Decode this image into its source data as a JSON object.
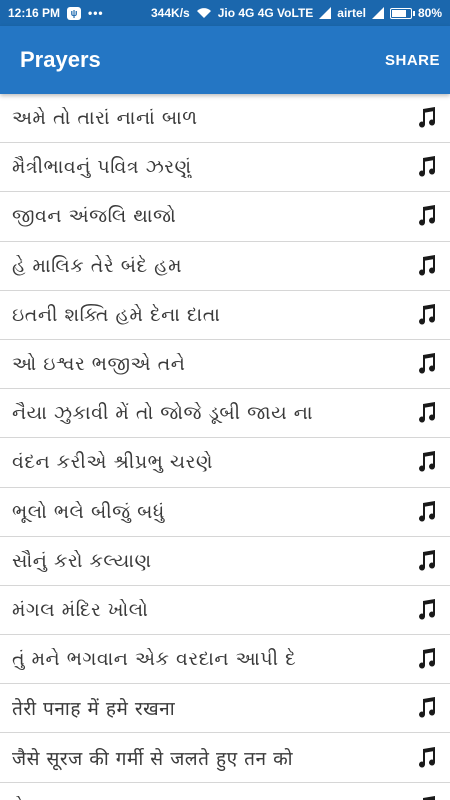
{
  "status_bar": {
    "time": "12:16 PM",
    "speed": "344K/s",
    "carrier1": "Jio 4G 4G VoLTE",
    "carrier2": "airtel",
    "battery": "80%",
    "battery_level": 0.8
  },
  "app_bar": {
    "title": "Prayers",
    "share_label": "SHARE"
  },
  "colors": {
    "status_bar": "#1b67ad",
    "app_bar": "#2476c4",
    "divider": "#d6d6d6",
    "text": "#3a3a3a"
  },
  "prayers": [
    {
      "title": "અમે તો તારાં નાનાં બાળ",
      "icon": "music-note-icon"
    },
    {
      "title": "મૈત્રીભાવનું પવિત્ર ઝરણું",
      "icon": "music-note-icon"
    },
    {
      "title": "જીવન અંજલિ થાજો",
      "icon": "music-note-icon"
    },
    {
      "title": "હે માલિક તેરે બંદે હમ",
      "icon": "music-note-icon"
    },
    {
      "title": "ઇતની શક્તિ હમે દેના દાતા",
      "icon": "music-note-icon"
    },
    {
      "title": "ઓ ઇશ્વર ભજીએ તને",
      "icon": "music-note-icon"
    },
    {
      "title": "નૈયા ઝુકાવી મેં તો જોજે ડૂબી જાય ના",
      "icon": "music-note-icon"
    },
    {
      "title": "વંદન કરીએ શ્રીપ્રભુ ચરણે",
      "icon": "music-note-icon"
    },
    {
      "title": "ભૂલો ભલે બીજું બધું",
      "icon": "music-note-icon"
    },
    {
      "title": "સૌનું કરો કલ્યાણ",
      "icon": "music-note-icon"
    },
    {
      "title": "મંગલ મંદિર ખોલો",
      "icon": "music-note-icon"
    },
    {
      "title": "તું મને ભગવાન  એક  વરદાન  આપી  દે",
      "icon": "music-note-icon"
    },
    {
      "title": "तेरी पनाह में हमे रखना",
      "icon": "music-note-icon"
    },
    {
      "title": "जैसे सूरज की गर्मी से जलते हुए तन को",
      "icon": "music-note-icon"
    },
    {
      "title": "હે પ્રભુજી …",
      "icon": "music-note-icon"
    }
  ]
}
